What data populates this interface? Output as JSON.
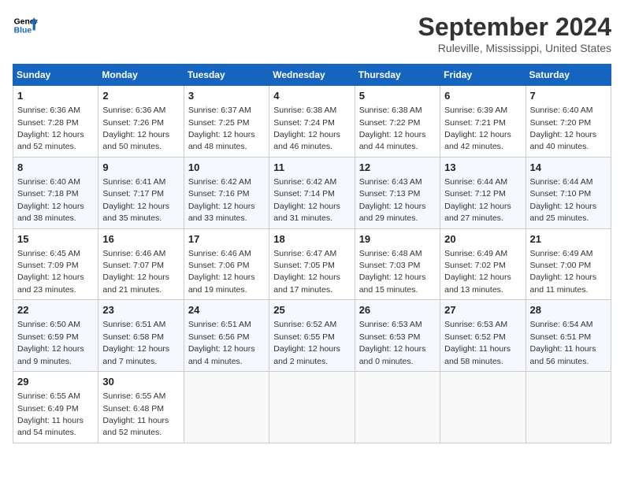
{
  "header": {
    "logo_line1": "General",
    "logo_line2": "Blue",
    "month_title": "September 2024",
    "location": "Ruleville, Mississippi, United States"
  },
  "weekdays": [
    "Sunday",
    "Monday",
    "Tuesday",
    "Wednesday",
    "Thursday",
    "Friday",
    "Saturday"
  ],
  "weeks": [
    [
      {
        "day": "1",
        "info": "Sunrise: 6:36 AM\nSunset: 7:28 PM\nDaylight: 12 hours\nand 52 minutes."
      },
      {
        "day": "2",
        "info": "Sunrise: 6:36 AM\nSunset: 7:26 PM\nDaylight: 12 hours\nand 50 minutes."
      },
      {
        "day": "3",
        "info": "Sunrise: 6:37 AM\nSunset: 7:25 PM\nDaylight: 12 hours\nand 48 minutes."
      },
      {
        "day": "4",
        "info": "Sunrise: 6:38 AM\nSunset: 7:24 PM\nDaylight: 12 hours\nand 46 minutes."
      },
      {
        "day": "5",
        "info": "Sunrise: 6:38 AM\nSunset: 7:22 PM\nDaylight: 12 hours\nand 44 minutes."
      },
      {
        "day": "6",
        "info": "Sunrise: 6:39 AM\nSunset: 7:21 PM\nDaylight: 12 hours\nand 42 minutes."
      },
      {
        "day": "7",
        "info": "Sunrise: 6:40 AM\nSunset: 7:20 PM\nDaylight: 12 hours\nand 40 minutes."
      }
    ],
    [
      {
        "day": "8",
        "info": "Sunrise: 6:40 AM\nSunset: 7:18 PM\nDaylight: 12 hours\nand 38 minutes."
      },
      {
        "day": "9",
        "info": "Sunrise: 6:41 AM\nSunset: 7:17 PM\nDaylight: 12 hours\nand 35 minutes."
      },
      {
        "day": "10",
        "info": "Sunrise: 6:42 AM\nSunset: 7:16 PM\nDaylight: 12 hours\nand 33 minutes."
      },
      {
        "day": "11",
        "info": "Sunrise: 6:42 AM\nSunset: 7:14 PM\nDaylight: 12 hours\nand 31 minutes."
      },
      {
        "day": "12",
        "info": "Sunrise: 6:43 AM\nSunset: 7:13 PM\nDaylight: 12 hours\nand 29 minutes."
      },
      {
        "day": "13",
        "info": "Sunrise: 6:44 AM\nSunset: 7:12 PM\nDaylight: 12 hours\nand 27 minutes."
      },
      {
        "day": "14",
        "info": "Sunrise: 6:44 AM\nSunset: 7:10 PM\nDaylight: 12 hours\nand 25 minutes."
      }
    ],
    [
      {
        "day": "15",
        "info": "Sunrise: 6:45 AM\nSunset: 7:09 PM\nDaylight: 12 hours\nand 23 minutes."
      },
      {
        "day": "16",
        "info": "Sunrise: 6:46 AM\nSunset: 7:07 PM\nDaylight: 12 hours\nand 21 minutes."
      },
      {
        "day": "17",
        "info": "Sunrise: 6:46 AM\nSunset: 7:06 PM\nDaylight: 12 hours\nand 19 minutes."
      },
      {
        "day": "18",
        "info": "Sunrise: 6:47 AM\nSunset: 7:05 PM\nDaylight: 12 hours\nand 17 minutes."
      },
      {
        "day": "19",
        "info": "Sunrise: 6:48 AM\nSunset: 7:03 PM\nDaylight: 12 hours\nand 15 minutes."
      },
      {
        "day": "20",
        "info": "Sunrise: 6:49 AM\nSunset: 7:02 PM\nDaylight: 12 hours\nand 13 minutes."
      },
      {
        "day": "21",
        "info": "Sunrise: 6:49 AM\nSunset: 7:00 PM\nDaylight: 12 hours\nand 11 minutes."
      }
    ],
    [
      {
        "day": "22",
        "info": "Sunrise: 6:50 AM\nSunset: 6:59 PM\nDaylight: 12 hours\nand 9 minutes."
      },
      {
        "day": "23",
        "info": "Sunrise: 6:51 AM\nSunset: 6:58 PM\nDaylight: 12 hours\nand 7 minutes."
      },
      {
        "day": "24",
        "info": "Sunrise: 6:51 AM\nSunset: 6:56 PM\nDaylight: 12 hours\nand 4 minutes."
      },
      {
        "day": "25",
        "info": "Sunrise: 6:52 AM\nSunset: 6:55 PM\nDaylight: 12 hours\nand 2 minutes."
      },
      {
        "day": "26",
        "info": "Sunrise: 6:53 AM\nSunset: 6:53 PM\nDaylight: 12 hours\nand 0 minutes."
      },
      {
        "day": "27",
        "info": "Sunrise: 6:53 AM\nSunset: 6:52 PM\nDaylight: 11 hours\nand 58 minutes."
      },
      {
        "day": "28",
        "info": "Sunrise: 6:54 AM\nSunset: 6:51 PM\nDaylight: 11 hours\nand 56 minutes."
      }
    ],
    [
      {
        "day": "29",
        "info": "Sunrise: 6:55 AM\nSunset: 6:49 PM\nDaylight: 11 hours\nand 54 minutes."
      },
      {
        "day": "30",
        "info": "Sunrise: 6:55 AM\nSunset: 6:48 PM\nDaylight: 11 hours\nand 52 minutes."
      },
      {
        "day": "",
        "info": ""
      },
      {
        "day": "",
        "info": ""
      },
      {
        "day": "",
        "info": ""
      },
      {
        "day": "",
        "info": ""
      },
      {
        "day": "",
        "info": ""
      }
    ]
  ]
}
